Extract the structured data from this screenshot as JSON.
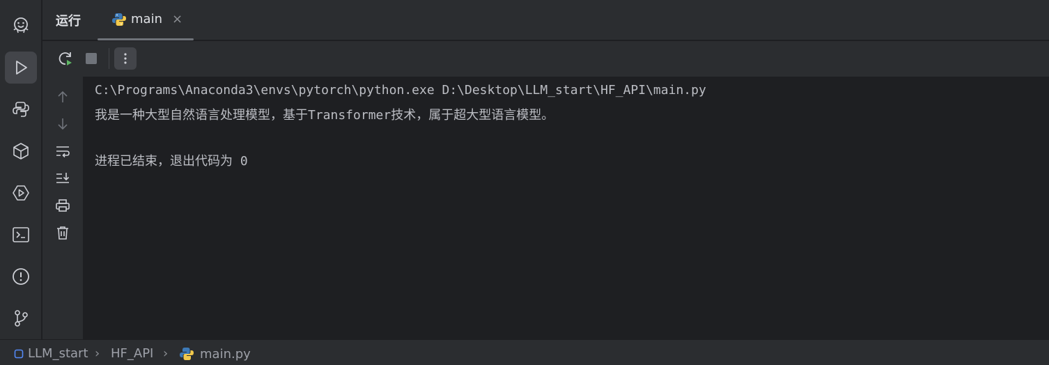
{
  "header": {
    "title": "运行",
    "tab_label": "main",
    "tab_close": "×"
  },
  "console": {
    "lines": [
      "C:\\Programs\\Anaconda3\\envs\\pytorch\\python.exe D:\\Desktop\\LLM_start\\HF_API\\main.py",
      "我是一种大型自然语言处理模型，基于Transformer技术，属于超大型语言模型。",
      "进程已结束，退出代码为 0"
    ]
  },
  "breadcrumb": {
    "items": [
      "LLM_start",
      "HF_API",
      "main.py"
    ],
    "separator": "›"
  },
  "colors": {
    "accent_green": "#5fb865",
    "icon_gray": "#ced0d6",
    "python_blue": "#3d7ab8",
    "python_yellow": "#f2c94c"
  }
}
